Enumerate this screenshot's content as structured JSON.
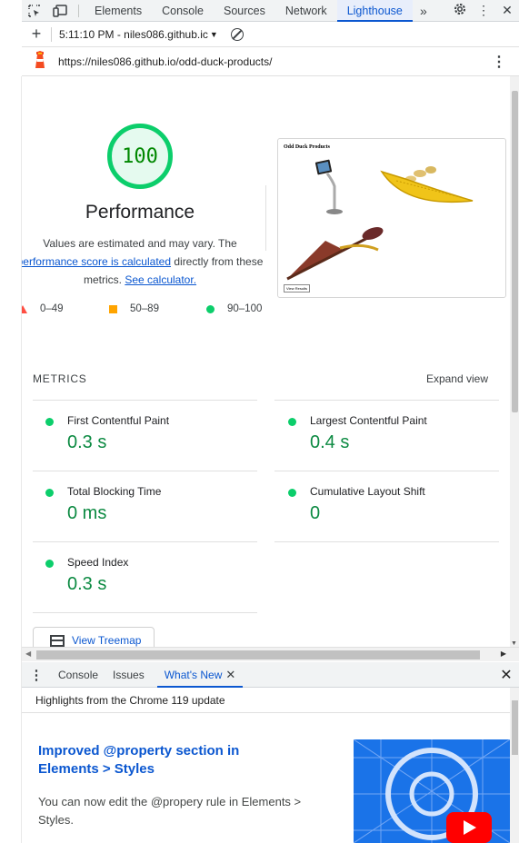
{
  "devtools": {
    "tabs": [
      "Elements",
      "Console",
      "Sources",
      "Network",
      "Lighthouse"
    ],
    "active_tab": "Lighthouse",
    "more_tabs_glyph": "»"
  },
  "lighthouse_toolbar": {
    "report_label": "5:11:10 PM - niles086.github.ic",
    "url": "https://niles086.github.io/odd-duck-products/"
  },
  "performance": {
    "score": "100",
    "title": "Performance",
    "desc_prefix": "Values are estimated and may vary. The",
    "desc_link": "performance score is calculated",
    "desc_suffix": " directly from these metrics.",
    "see_calculator": "See calculator.",
    "legend": [
      {
        "range": "0–49",
        "color": "#ff4e42"
      },
      {
        "range": "50–89",
        "color": "#ffa400"
      },
      {
        "range": "90–100",
        "color": "#0cce6b"
      }
    ]
  },
  "screenshot": {
    "page_title": "Odd Duck Products",
    "button_label": "View Results"
  },
  "metrics": {
    "header": "METRICS",
    "expand_label": "Expand view",
    "items": [
      {
        "name": "First Contentful Paint",
        "value": "0.3 s"
      },
      {
        "name": "Largest Contentful Paint",
        "value": "0.4 s"
      },
      {
        "name": "Total Blocking Time",
        "value": "0 ms"
      },
      {
        "name": "Cumulative Layout Shift",
        "value": "0"
      },
      {
        "name": "Speed Index",
        "value": "0.3 s"
      }
    ],
    "treemap_label": "View Treemap"
  },
  "drawer": {
    "tabs": [
      "Console",
      "Issues",
      "What's New"
    ],
    "active_tab": "What's New",
    "header": "Highlights from the Chrome 119 update",
    "article_title": "Improved @property section in Elements > Styles",
    "article_text": "You can now edit the @propery rule in Elements > Styles."
  },
  "colors": {
    "accent": "#0b57d0",
    "pass": "#0cce6b",
    "score_text": "#008800"
  }
}
